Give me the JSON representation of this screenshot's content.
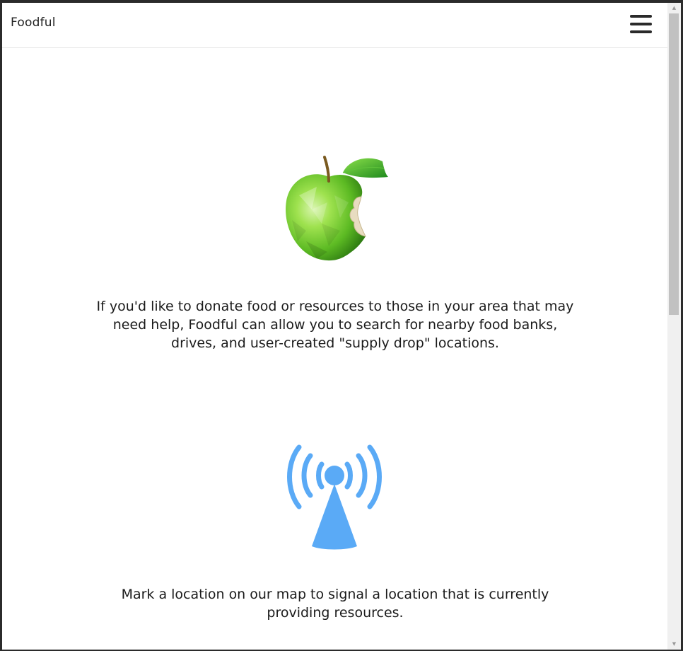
{
  "navbar": {
    "brand": "Foodful",
    "menu_icon": "hamburger-menu-icon"
  },
  "features": [
    {
      "icon": "green-apple-icon",
      "text": "If you'd like to donate food or resources to those in your area that may need help, Foodful can allow you to search for nearby food banks, drives, and user-created \"supply drop\" locations."
    },
    {
      "icon": "broadcast-tower-icon",
      "text": "Mark a location on our map to signal a location that is currently providing resources."
    }
  ],
  "colors": {
    "apple_green": "#7ed13a",
    "tower_blue": "#5aaaf6"
  }
}
